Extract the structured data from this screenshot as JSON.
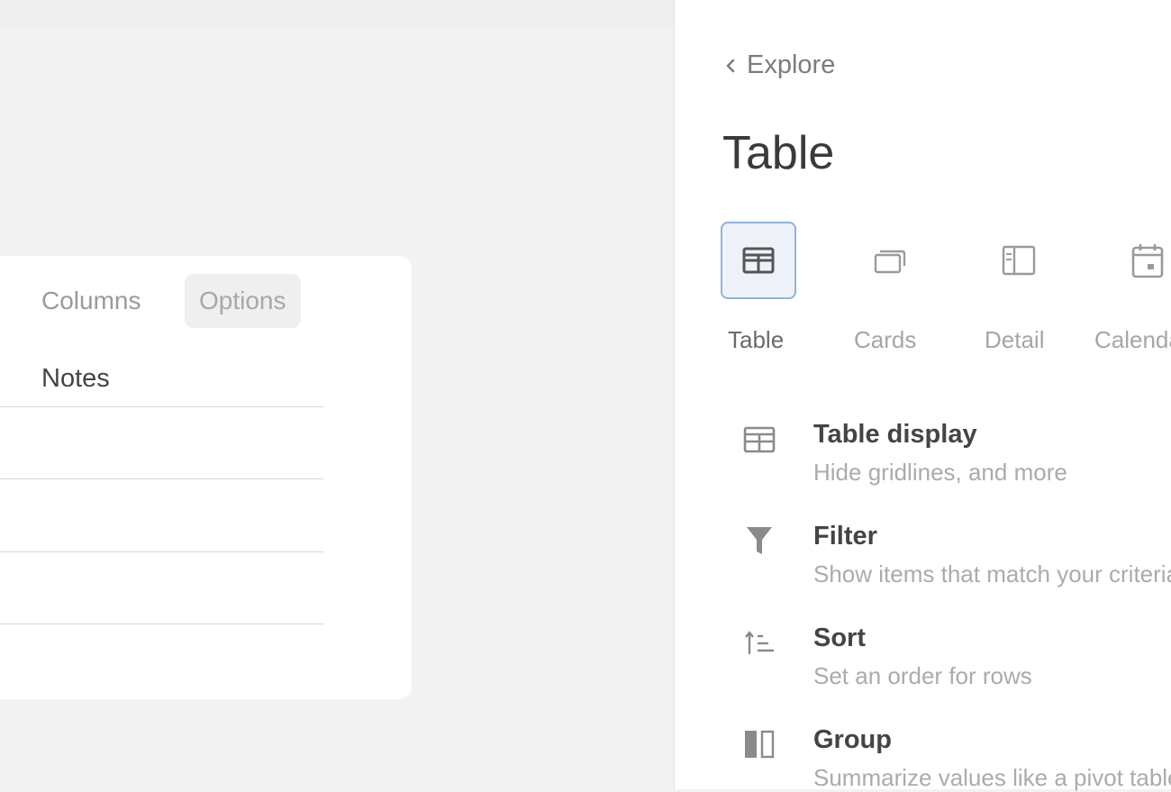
{
  "table_card": {
    "tabs": [
      {
        "label": "Columns"
      },
      {
        "label": "Options"
      }
    ],
    "column_header": "Notes"
  },
  "panel": {
    "back_label": "Explore",
    "title": "Table",
    "layouts": [
      {
        "label": "Table",
        "icon": "table-icon",
        "selected": true
      },
      {
        "label": "Cards",
        "icon": "cards-icon",
        "selected": false
      },
      {
        "label": "Detail",
        "icon": "detail-icon",
        "selected": false
      },
      {
        "label": "Calendar",
        "icon": "calendar-icon",
        "selected": false
      }
    ],
    "settings": [
      {
        "title": "Table display",
        "description": "Hide gridlines, and more",
        "icon": "table-icon"
      },
      {
        "title": "Filter",
        "description": "Show items that match your criteria",
        "icon": "filter-icon"
      },
      {
        "title": "Sort",
        "description": "Set an order for rows",
        "icon": "sort-icon"
      },
      {
        "title": "Group",
        "description": "Summarize values like a pivot table",
        "icon": "group-icon"
      }
    ]
  },
  "colors": {
    "selected_border": "#8fb3da",
    "selected_fill": "#eef3f9"
  }
}
